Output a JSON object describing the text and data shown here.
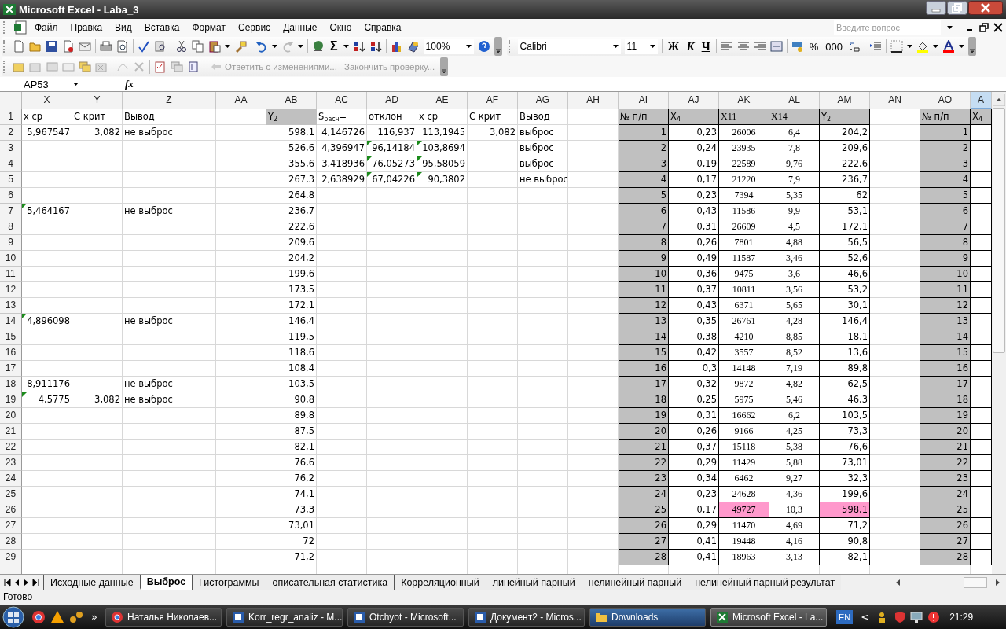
{
  "window": {
    "title": "Microsoft Excel - Laba_3"
  },
  "menu": [
    "Файл",
    "Правка",
    "Вид",
    "Вставка",
    "Формат",
    "Сервис",
    "Данные",
    "Окно",
    "Справка"
  ],
  "help_search": {
    "placeholder": "Введите вопрос"
  },
  "standard_toolbar": {
    "sum": "Σ",
    "zoom": "100%"
  },
  "formatting_toolbar": {
    "font": "Calibri",
    "size": "11",
    "bold": "Ж",
    "italic": "К",
    "underline": "Ч",
    "percent": "%",
    "thousands": "000"
  },
  "review_toolbar": {
    "reply": "Ответить с изменениями...",
    "end_review": "Закончить проверку..."
  },
  "formula_bar": {
    "name_box": "AP53",
    "function_label": "fx"
  },
  "sheet": {
    "columns": [
      {
        "label": "X",
        "kind": "number",
        "bordered": false,
        "selected": false
      },
      {
        "label": "Y",
        "kind": "number",
        "bordered": false,
        "selected": false
      },
      {
        "label": "Z",
        "kind": "text",
        "bordered": false,
        "selected": false
      },
      {
        "label": "AA",
        "kind": "number",
        "bordered": false,
        "selected": false
      },
      {
        "label": "AB",
        "kind": "number",
        "bordered": false,
        "selected": false
      },
      {
        "label": "AC",
        "kind": "number",
        "bordered": false,
        "selected": false
      },
      {
        "label": "AD",
        "kind": "number",
        "bordered": false,
        "selected": false
      },
      {
        "label": "AE",
        "kind": "number",
        "bordered": false,
        "selected": false
      },
      {
        "label": "AF",
        "kind": "number",
        "bordered": false,
        "selected": false
      },
      {
        "label": "AG",
        "kind": "text",
        "bordered": false,
        "selected": false
      },
      {
        "label": "AH",
        "kind": "number",
        "bordered": false,
        "selected": false
      },
      {
        "label": "AI",
        "kind": "number",
        "bordered": true,
        "selected": false
      },
      {
        "label": "AJ",
        "kind": "number",
        "bordered": true,
        "selected": false
      },
      {
        "label": "AK",
        "kind": "measure",
        "bordered": true,
        "selected": false
      },
      {
        "label": "AL",
        "kind": "measure",
        "bordered": true,
        "selected": false
      },
      {
        "label": "AM",
        "kind": "number",
        "bordered": true,
        "selected": false
      },
      {
        "label": "AN",
        "kind": "number",
        "bordered": false,
        "selected": false
      },
      {
        "label": "AO",
        "kind": "number",
        "bordered": true,
        "selected": false
      },
      {
        "label": "A",
        "kind": "number",
        "bordered": true,
        "selected": true
      }
    ],
    "rows": [
      {
        "number": "1",
        "kind": "header",
        "cells": [
          {
            "text": "x ср"
          },
          {
            "text": "С крит"
          },
          {
            "text": "Вывод"
          },
          null,
          {
            "text": "Y$_{2}$",
            "color": "#c0c0c0"
          },
          {
            "text": "S$_{расч}$="
          },
          {
            "text": "отклон"
          },
          {
            "text": "x ср"
          },
          {
            "text": "С крит"
          },
          {
            "text": "Вывод"
          },
          null,
          {
            "text": "№ п/п",
            "color": "#c0c0c0"
          },
          {
            "text": "X$_{4}$",
            "color": "#c0c0c0"
          },
          {
            "text": "X11",
            "color": "#c0c0c0"
          },
          {
            "text": "X14",
            "color": "#c0c0c0"
          },
          {
            "text": "Y$_{2}$",
            "color": "#c0c0c0"
          },
          null,
          {
            "text": "№ п/п",
            "color": "#c0c0c0"
          },
          {
            "text": "X$_{4}$",
            "color": "#c0c0c0"
          }
        ]
      },
      {
        "number": "2",
        "kind": "data",
        "cells": [
          {
            "text": "5,967547"
          },
          {
            "text": "3,082"
          },
          {
            "text": "не выброс"
          },
          null,
          {
            "text": "598,1"
          },
          {
            "text": "4,146726"
          },
          {
            "text": "116,937"
          },
          {
            "text": "113,1945"
          },
          {
            "text": "3,082"
          },
          {
            "text": "выброс"
          },
          null,
          {
            "text": "1",
            "color": "#c0c0c0"
          },
          {
            "text": "0,23"
          },
          {
            "text": "26006"
          },
          {
            "text": "6,4"
          },
          {
            "text": "204,2"
          },
          null,
          {
            "text": "1",
            "color": "#c0c0c0"
          },
          null
        ]
      },
      {
        "number": "3",
        "kind": "data",
        "cells": [
          null,
          null,
          null,
          null,
          {
            "text": "526,6"
          },
          {
            "text": "4,396947"
          },
          {
            "text": "96,14184",
            "flag": true
          },
          {
            "text": "103,8694",
            "flag": true
          },
          null,
          {
            "text": "выброс"
          },
          null,
          {
            "text": "2",
            "color": "#c0c0c0"
          },
          {
            "text": "0,24"
          },
          {
            "text": "23935"
          },
          {
            "text": "7,8"
          },
          {
            "text": "209,6"
          },
          null,
          {
            "text": "2",
            "color": "#c0c0c0"
          },
          null
        ]
      },
      {
        "number": "4",
        "kind": "data",
        "cells": [
          null,
          null,
          null,
          null,
          {
            "text": "355,6"
          },
          {
            "text": "3,418936"
          },
          {
            "text": "76,05273",
            "flag": true
          },
          {
            "text": "95,58059",
            "flag": true
          },
          null,
          {
            "text": "выброс"
          },
          null,
          {
            "text": "3",
            "color": "#c0c0c0"
          },
          {
            "text": "0,19"
          },
          {
            "text": "22589"
          },
          {
            "text": "9,76"
          },
          {
            "text": "222,6"
          },
          null,
          {
            "text": "3",
            "color": "#c0c0c0"
          },
          null
        ]
      },
      {
        "number": "5",
        "kind": "data",
        "cells": [
          null,
          null,
          null,
          null,
          {
            "text": "267,3"
          },
          {
            "text": "2,638929"
          },
          {
            "text": "67,04226",
            "flag": true
          },
          {
            "text": "90,3802",
            "flag": true
          },
          null,
          {
            "text": "не выброс"
          },
          null,
          {
            "text": "4",
            "color": "#c0c0c0"
          },
          {
            "text": "0,17"
          },
          {
            "text": "21220"
          },
          {
            "text": "7,9"
          },
          {
            "text": "236,7"
          },
          null,
          {
            "text": "4",
            "color": "#c0c0c0"
          },
          null
        ]
      },
      {
        "number": "6",
        "kind": "data",
        "cells": [
          null,
          null,
          null,
          null,
          {
            "text": "264,8"
          },
          null,
          null,
          null,
          null,
          null,
          null,
          {
            "text": "5",
            "color": "#c0c0c0"
          },
          {
            "text": "0,23"
          },
          {
            "text": "7394"
          },
          {
            "text": "5,35"
          },
          {
            "text": "62"
          },
          null,
          {
            "text": "5",
            "color": "#c0c0c0"
          },
          null
        ]
      },
      {
        "number": "7",
        "kind": "data",
        "cells": [
          {
            "text": "5,464167",
            "flag": true
          },
          null,
          {
            "text": "не выброс"
          },
          null,
          {
            "text": "236,7"
          },
          null,
          null,
          null,
          null,
          null,
          null,
          {
            "text": "6",
            "color": "#c0c0c0"
          },
          {
            "text": "0,43"
          },
          {
            "text": "11586"
          },
          {
            "text": "9,9"
          },
          {
            "text": "53,1"
          },
          null,
          {
            "text": "6",
            "color": "#c0c0c0"
          },
          null
        ]
      },
      {
        "number": "8",
        "kind": "data",
        "cells": [
          null,
          null,
          null,
          null,
          {
            "text": "222,6"
          },
          null,
          null,
          null,
          null,
          null,
          null,
          {
            "text": "7",
            "color": "#c0c0c0"
          },
          {
            "text": "0,31"
          },
          {
            "text": "26609"
          },
          {
            "text": "4,5"
          },
          {
            "text": "172,1"
          },
          null,
          {
            "text": "7",
            "color": "#c0c0c0"
          },
          null
        ]
      },
      {
        "number": "9",
        "kind": "data",
        "cells": [
          null,
          null,
          null,
          null,
          {
            "text": "209,6"
          },
          null,
          null,
          null,
          null,
          null,
          null,
          {
            "text": "8",
            "color": "#c0c0c0"
          },
          {
            "text": "0,26"
          },
          {
            "text": "7801"
          },
          {
            "text": "4,88"
          },
          {
            "text": "56,5"
          },
          null,
          {
            "text": "8",
            "color": "#c0c0c0"
          },
          null
        ]
      },
      {
        "number": "10",
        "kind": "data",
        "cells": [
          null,
          null,
          null,
          null,
          {
            "text": "204,2"
          },
          null,
          null,
          null,
          null,
          null,
          null,
          {
            "text": "9",
            "color": "#c0c0c0"
          },
          {
            "text": "0,49"
          },
          {
            "text": "11587"
          },
          {
            "text": "3,46"
          },
          {
            "text": "52,6"
          },
          null,
          {
            "text": "9",
            "color": "#c0c0c0"
          },
          null
        ]
      },
      {
        "number": "11",
        "kind": "data",
        "cells": [
          null,
          null,
          null,
          null,
          {
            "text": "199,6"
          },
          null,
          null,
          null,
          null,
          null,
          null,
          {
            "text": "10",
            "color": "#c0c0c0"
          },
          {
            "text": "0,36"
          },
          {
            "text": "9475"
          },
          {
            "text": "3,6"
          },
          {
            "text": "46,6"
          },
          null,
          {
            "text": "10",
            "color": "#c0c0c0"
          },
          null
        ]
      },
      {
        "number": "12",
        "kind": "data",
        "cells": [
          null,
          null,
          null,
          null,
          {
            "text": "173,5"
          },
          null,
          null,
          null,
          null,
          null,
          null,
          {
            "text": "11",
            "color": "#c0c0c0"
          },
          {
            "text": "0,37"
          },
          {
            "text": "10811"
          },
          {
            "text": "3,56"
          },
          {
            "text": "53,2"
          },
          null,
          {
            "text": "11",
            "color": "#c0c0c0"
          },
          null
        ]
      },
      {
        "number": "13",
        "kind": "data",
        "cells": [
          null,
          null,
          null,
          null,
          {
            "text": "172,1"
          },
          null,
          null,
          null,
          null,
          null,
          null,
          {
            "text": "12",
            "color": "#c0c0c0"
          },
          {
            "text": "0,43"
          },
          {
            "text": "6371"
          },
          {
            "text": "5,65"
          },
          {
            "text": "30,1"
          },
          null,
          {
            "text": "12",
            "color": "#c0c0c0"
          },
          null
        ]
      },
      {
        "number": "14",
        "kind": "data",
        "cells": [
          {
            "text": "4,896098",
            "flag": true
          },
          null,
          {
            "text": "не выброс"
          },
          null,
          {
            "text": "146,4"
          },
          null,
          null,
          null,
          null,
          null,
          null,
          {
            "text": "13",
            "color": "#c0c0c0"
          },
          {
            "text": "0,35"
          },
          {
            "text": "26761"
          },
          {
            "text": "4,28"
          },
          {
            "text": "146,4"
          },
          null,
          {
            "text": "13",
            "color": "#c0c0c0"
          },
          null
        ]
      },
      {
        "number": "15",
        "kind": "data",
        "cells": [
          null,
          null,
          null,
          null,
          {
            "text": "119,5"
          },
          null,
          null,
          null,
          null,
          null,
          null,
          {
            "text": "14",
            "color": "#c0c0c0"
          },
          {
            "text": "0,38"
          },
          {
            "text": "4210"
          },
          {
            "text": "8,85"
          },
          {
            "text": "18,1"
          },
          null,
          {
            "text": "14",
            "color": "#c0c0c0"
          },
          null
        ]
      },
      {
        "number": "16",
        "kind": "data",
        "cells": [
          null,
          null,
          null,
          null,
          {
            "text": "118,6"
          },
          null,
          null,
          null,
          null,
          null,
          null,
          {
            "text": "15",
            "color": "#c0c0c0"
          },
          {
            "text": "0,42"
          },
          {
            "text": "3557"
          },
          {
            "text": "8,52"
          },
          {
            "text": "13,6"
          },
          null,
          {
            "text": "15",
            "color": "#c0c0c0"
          },
          null
        ]
      },
      {
        "number": "17",
        "kind": "data",
        "cells": [
          null,
          null,
          null,
          null,
          {
            "text": "108,4"
          },
          null,
          null,
          null,
          null,
          null,
          null,
          {
            "text": "16",
            "color": "#c0c0c0"
          },
          {
            "text": "0,3"
          },
          {
            "text": "14148"
          },
          {
            "text": "7,19"
          },
          {
            "text": "89,8"
          },
          null,
          {
            "text": "16",
            "color": "#c0c0c0"
          },
          null
        ]
      },
      {
        "number": "18",
        "kind": "data",
        "cells": [
          {
            "text": "8,911176"
          },
          null,
          {
            "text": "не выброс"
          },
          null,
          {
            "text": "103,5"
          },
          null,
          null,
          null,
          null,
          null,
          null,
          {
            "text": "17",
            "color": "#c0c0c0"
          },
          {
            "text": "0,32"
          },
          {
            "text": "9872"
          },
          {
            "text": "4,82"
          },
          {
            "text": "62,5"
          },
          null,
          {
            "text": "17",
            "color": "#c0c0c0"
          },
          null
        ]
      },
      {
        "number": "19",
        "kind": "data",
        "cells": [
          {
            "text": "4,5775",
            "flag": true
          },
          {
            "text": "3,082"
          },
          {
            "text": "не выброс"
          },
          null,
          {
            "text": "90,8"
          },
          null,
          null,
          null,
          null,
          null,
          null,
          {
            "text": "18",
            "color": "#c0c0c0"
          },
          {
            "text": "0,25"
          },
          {
            "text": "5975"
          },
          {
            "text": "5,46"
          },
          {
            "text": "46,3"
          },
          null,
          {
            "text": "18",
            "color": "#c0c0c0"
          },
          null
        ]
      },
      {
        "number": "20",
        "kind": "data",
        "cells": [
          null,
          null,
          null,
          null,
          {
            "text": "89,8"
          },
          null,
          null,
          null,
          null,
          null,
          null,
          {
            "text": "19",
            "color": "#c0c0c0"
          },
          {
            "text": "0,31"
          },
          {
            "text": "16662"
          },
          {
            "text": "6,2"
          },
          {
            "text": "103,5"
          },
          null,
          {
            "text": "19",
            "color": "#c0c0c0"
          },
          null
        ]
      },
      {
        "number": "21",
        "kind": "data",
        "cells": [
          null,
          null,
          null,
          null,
          {
            "text": "87,5"
          },
          null,
          null,
          null,
          null,
          null,
          null,
          {
            "text": "20",
            "color": "#c0c0c0"
          },
          {
            "text": "0,26"
          },
          {
            "text": "9166"
          },
          {
            "text": "4,25"
          },
          {
            "text": "73,3"
          },
          null,
          {
            "text": "20",
            "color": "#c0c0c0"
          },
          null
        ]
      },
      {
        "number": "22",
        "kind": "data",
        "cells": [
          null,
          null,
          null,
          null,
          {
            "text": "82,1"
          },
          null,
          null,
          null,
          null,
          null,
          null,
          {
            "text": "21",
            "color": "#c0c0c0"
          },
          {
            "text": "0,37"
          },
          {
            "text": "15118"
          },
          {
            "text": "5,38"
          },
          {
            "text": "76,6"
          },
          null,
          {
            "text": "21",
            "color": "#c0c0c0"
          },
          null
        ]
      },
      {
        "number": "23",
        "kind": "data",
        "cells": [
          null,
          null,
          null,
          null,
          {
            "text": "76,6"
          },
          null,
          null,
          null,
          null,
          null,
          null,
          {
            "text": "22",
            "color": "#c0c0c0"
          },
          {
            "text": "0,29"
          },
          {
            "text": "11429"
          },
          {
            "text": "5,88"
          },
          {
            "text": "73,01"
          },
          null,
          {
            "text": "22",
            "color": "#c0c0c0"
          },
          null
        ]
      },
      {
        "number": "24",
        "kind": "data",
        "cells": [
          null,
          null,
          null,
          null,
          {
            "text": "76,2"
          },
          null,
          null,
          null,
          null,
          null,
          null,
          {
            "text": "23",
            "color": "#c0c0c0"
          },
          {
            "text": "0,34"
          },
          {
            "text": "6462"
          },
          {
            "text": "9,27"
          },
          {
            "text": "32,3"
          },
          null,
          {
            "text": "23",
            "color": "#c0c0c0"
          },
          null
        ]
      },
      {
        "number": "25",
        "kind": "data",
        "cells": [
          null,
          null,
          null,
          null,
          {
            "text": "74,1"
          },
          null,
          null,
          null,
          null,
          null,
          null,
          {
            "text": "24",
            "color": "#c0c0c0"
          },
          {
            "text": "0,23"
          },
          {
            "text": "24628"
          },
          {
            "text": "4,36"
          },
          {
            "text": "199,6"
          },
          null,
          {
            "text": "24",
            "color": "#c0c0c0"
          },
          null
        ]
      },
      {
        "number": "26",
        "kind": "data",
        "cells": [
          null,
          null,
          null,
          null,
          {
            "text": "73,3"
          },
          null,
          null,
          null,
          null,
          null,
          null,
          {
            "text": "25",
            "color": "#c0c0c0"
          },
          {
            "text": "0,17"
          },
          {
            "text": "49727",
            "color": "#ff99cc"
          },
          {
            "text": "10,3"
          },
          {
            "text": "598,1",
            "color": "#ff99cc"
          },
          null,
          {
            "text": "25",
            "color": "#c0c0c0"
          },
          null
        ]
      },
      {
        "number": "27",
        "kind": "data",
        "cells": [
          null,
          null,
          null,
          null,
          {
            "text": "73,01"
          },
          null,
          null,
          null,
          null,
          null,
          null,
          {
            "text": "26",
            "color": "#c0c0c0"
          },
          {
            "text": "0,29"
          },
          {
            "text": "11470"
          },
          {
            "text": "4,69"
          },
          {
            "text": "71,2"
          },
          null,
          {
            "text": "26",
            "color": "#c0c0c0"
          },
          null
        ]
      },
      {
        "number": "28",
        "kind": "data",
        "cells": [
          null,
          null,
          null,
          null,
          {
            "text": "72"
          },
          null,
          null,
          null,
          null,
          null,
          null,
          {
            "text": "27",
            "color": "#c0c0c0"
          },
          {
            "text": "0,41"
          },
          {
            "text": "19448"
          },
          {
            "text": "4,16"
          },
          {
            "text": "90,8"
          },
          null,
          {
            "text": "27",
            "color": "#c0c0c0"
          },
          null
        ]
      },
      {
        "number": "29",
        "kind": "data",
        "cells": [
          null,
          null,
          null,
          null,
          {
            "text": "71,2"
          },
          null,
          null,
          null,
          null,
          null,
          null,
          {
            "text": "28",
            "color": "#c0c0c0"
          },
          {
            "text": "0,41"
          },
          {
            "text": "18963"
          },
          {
            "text": "3,13"
          },
          {
            "text": "82,1"
          },
          null,
          {
            "text": "28",
            "color": "#c0c0c0"
          },
          null
        ]
      }
    ]
  },
  "sheet_tabs": [
    {
      "label": "Исходные данные",
      "selected": false
    },
    {
      "label": "Выброс",
      "selected": true
    },
    {
      "label": "Гистограммы",
      "selected": false
    },
    {
      "label": "описательная статистика",
      "selected": false
    },
    {
      "label": "Корреляционный",
      "selected": false
    },
    {
      "label": "линейный парный",
      "selected": false
    },
    {
      "label": "нелинейный парный",
      "selected": false
    },
    {
      "label": "нелинейный парный результат",
      "selected": false
    }
  ],
  "status_bar": "Готово",
  "taskbar": {
    "more": "»",
    "tasks": [
      {
        "label": "Наталья Николаев...",
        "kind": "browser",
        "selected": false
      },
      {
        "label": "Korr_regr_analiz - M...",
        "kind": "word",
        "selected": false
      },
      {
        "label": "Otchyot - Microsoft...",
        "kind": "word",
        "selected": false
      },
      {
        "label": "Документ2 - Micros...",
        "kind": "word",
        "selected": false
      },
      {
        "label": "Downloads",
        "kind": "folder",
        "selected": false
      },
      {
        "label": "Microsoft Excel - La...",
        "kind": "excel",
        "selected": true
      }
    ],
    "language": "EN",
    "tray_expand": "<",
    "clock": "21:29"
  }
}
